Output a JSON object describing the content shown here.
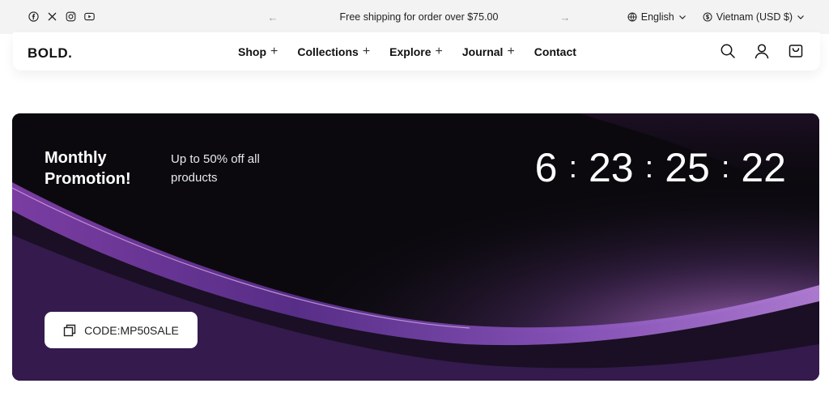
{
  "topbar": {
    "social_icons": [
      "facebook-icon",
      "x-icon",
      "instagram-icon",
      "youtube-icon"
    ],
    "announcement": "Free shipping for order over $75.00",
    "prev_arrow": "←",
    "next_arrow": "→",
    "language": "English",
    "currency": "Vietnam (USD $)"
  },
  "header": {
    "logo": "BOLD.",
    "nav": [
      {
        "label": "Shop",
        "has_submenu": true
      },
      {
        "label": "Collections",
        "has_submenu": true
      },
      {
        "label": "Explore",
        "has_submenu": true
      },
      {
        "label": "Journal",
        "has_submenu": true
      },
      {
        "label": "Contact",
        "has_submenu": false
      }
    ],
    "submenu_symbol": "+",
    "icons": [
      "search-icon",
      "account-icon",
      "cart-icon"
    ]
  },
  "promo": {
    "title": "Monthly Promotion!",
    "subtitle": "Up to 50% off all products",
    "countdown": {
      "days": "6",
      "hours": "23",
      "minutes": "25",
      "seconds": "22",
      "separator": ":"
    },
    "code_label": "CODE:MP50SALE",
    "colors": {
      "background": "#0c0a10",
      "accent": "#a66ac9"
    }
  }
}
